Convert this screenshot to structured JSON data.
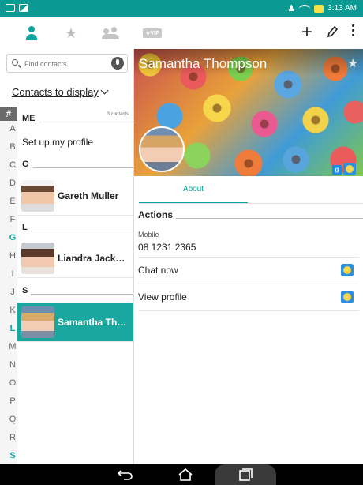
{
  "status_bar": {
    "time": "3:13 AM"
  },
  "toolbar": {
    "tabs": [
      "contacts",
      "favorites",
      "groups",
      "vip"
    ],
    "vip_label": "★VIP",
    "add_icon": "plus-icon",
    "edit_icon": "pencil-icon",
    "more_icon": "more-vert-icon"
  },
  "search": {
    "placeholder": "Find contacts"
  },
  "display_selector": {
    "label": "Contacts to display"
  },
  "alpha_index": {
    "header": "#",
    "letters": [
      "A",
      "B",
      "C",
      "D",
      "E",
      "F",
      "G",
      "H",
      "I",
      "J",
      "K",
      "L",
      "M",
      "N",
      "O",
      "P",
      "Q",
      "R",
      "S"
    ],
    "active": [
      "G",
      "L",
      "S"
    ]
  },
  "contact_list": {
    "me_header": "ME",
    "me_count": "3 contacts",
    "setup_profile": "Set up my profile",
    "sections": [
      {
        "letter": "G",
        "contacts": [
          {
            "name": "Gareth Muller"
          }
        ]
      },
      {
        "letter": "L",
        "contacts": [
          {
            "name": "Liandra Jack…"
          }
        ]
      },
      {
        "letter": "S",
        "contacts": [
          {
            "name": "Samantha Th…",
            "selected": true
          }
        ]
      }
    ]
  },
  "detail": {
    "name": "Samantha Thompson",
    "tab_about": "About",
    "actions_header": "Actions",
    "mobile_label": "Mobile",
    "mobile_number": "08 1231 2365",
    "chat_now": "Chat now",
    "view_profile": "View profile",
    "badge_g": "g"
  },
  "colors": {
    "accent": "#0ba59d",
    "status_bar": "#0a9a93",
    "selected_row": "#1aa79f"
  }
}
